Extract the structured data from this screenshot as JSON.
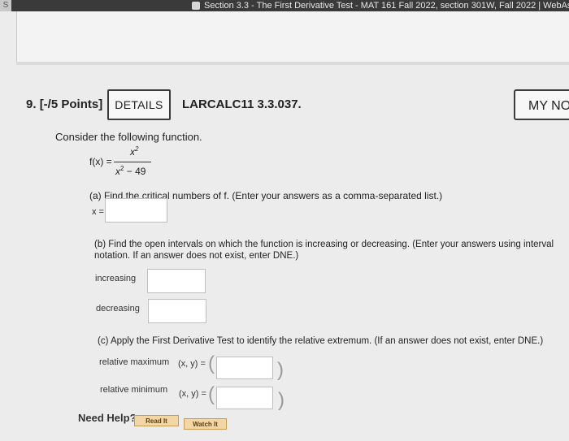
{
  "browser": {
    "window_title": "Section 3.3 - The First Derivative Test - MAT 161 Fall 2022, section 301W, Fall 2022 | WebAssign"
  },
  "question": {
    "number_label": "9.",
    "points_label": "[-/5 Points]",
    "details_label": "DETAILS",
    "reference": "LARCALC11 3.3.037.",
    "my_notes_label": "MY NO",
    "intro": "Consider the following function.",
    "function": {
      "lhs": "f(x) =",
      "numerator": "x",
      "numerator_exp": "2",
      "denominator_base": "x",
      "denominator_exp": "2",
      "denominator_rest": " − 49"
    },
    "part_a": {
      "prompt": "(a) Find the critical numbers of f. (Enter your answers as a comma-separated list.)",
      "input_label": "x =",
      "value": ""
    },
    "part_b": {
      "prompt": "(b) Find the open intervals on which the function is increasing or decreasing. (Enter your answers using interval notation. If an answer does not exist, enter DNE.)",
      "increasing_label": "increasing",
      "increasing_value": "",
      "decreasing_label": "decreasing",
      "decreasing_value": ""
    },
    "part_c": {
      "prompt": "(c) Apply the First Derivative Test to identify the relative extremum. (If an answer does not exist, enter DNE.)",
      "max_label": "relative maximum",
      "min_label": "relative minimum",
      "xy_label": "(x, y) =",
      "max_value": "",
      "min_value": ""
    },
    "help": {
      "need_help": "Need Help?",
      "read_it": "Read It",
      "watch_it": "Watch It"
    }
  }
}
